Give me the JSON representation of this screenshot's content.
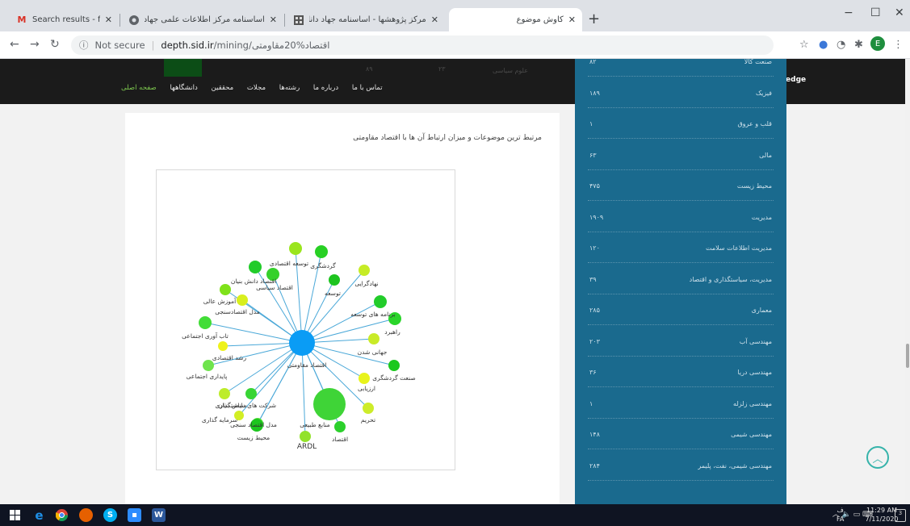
{
  "browser": {
    "tabs": [
      {
        "title": "Search results - f.azimzadeh@gm",
        "icon": "gmail-icon",
        "active": false
      },
      {
        "title": "اساسنامه مرکز اطلاعات علمی جهاد",
        "icon": "chrome-icon",
        "active": false
      },
      {
        "title": "مرکز پژوهشها - اساسنامه جهاد دانا",
        "icon": "site-icon",
        "active": false
      },
      {
        "title": "کاوش موضوع",
        "icon": "none",
        "active": true
      }
    ],
    "new_tab": "+",
    "window_buttons": {
      "minimize": "−",
      "maximize": "☐",
      "close": "✕"
    },
    "not_secure": "Not secure",
    "url_host": "depth.sid.ir",
    "url_path": "/mining/اقتصاد%20مقاومتی",
    "profile_letter": "E"
  },
  "site": {
    "logo_text": "Depth of Knowledge",
    "menu": [
      "صفحه اصلی",
      "دانشگاهها",
      "محققین",
      "مجلات",
      "رشته‌ها",
      "درباره ما",
      "تماس با ما"
    ],
    "ghost_texts": [
      "علوم سیاسی",
      "۲۳",
      "۸۹"
    ],
    "card_title": "مرتبط ترین موضوعات و میزان ارتباط آن ها با اقتصاد مقاومتی",
    "graph": {
      "center": "اقتصاد مقاومتی",
      "nodes": [
        {
          "label": "توسعه اقتصادی",
          "color": "#9ae51e",
          "r": 8
        },
        {
          "label": "گردشگری",
          "color": "#28d024",
          "r": 8
        },
        {
          "label": "اقتصاد دانش بنیان",
          "color": "#22cc2a",
          "r": 8
        },
        {
          "label": "اقتصاد سیاسی",
          "color": "#36d12b",
          "r": 8
        },
        {
          "label": "توسعه",
          "color": "#1dc41f",
          "r": 7
        },
        {
          "label": "نهادگرایی",
          "color": "#c6ec26",
          "r": 7
        },
        {
          "label": "آموزش عالی",
          "color": "#7fe21a",
          "r": 7
        },
        {
          "label": "مدل اقتصادسنجی",
          "color": "#d8ef1e",
          "r": 7
        },
        {
          "label": "برنامه های توسعه",
          "color": "#22cc2a",
          "r": 8
        },
        {
          "label": "راهبرد",
          "color": "#2ad52a",
          "r": 8
        },
        {
          "label": "تاب آوری اجتماعی",
          "color": "#42dd37",
          "r": 8
        },
        {
          "label": "جهانی شدن",
          "color": "#c9eb28",
          "r": 7
        },
        {
          "label": "رشد اقتصادی",
          "color": "#eef21a",
          "r": 6
        },
        {
          "label": "پایداری اجتماعی",
          "color": "#6fe44d",
          "r": 7
        },
        {
          "label": "صنعت گردشگری",
          "color": "#1bc81d",
          "r": 7
        },
        {
          "label": "ارزیابی",
          "color": "#e8f31c",
          "r": 7
        },
        {
          "label": "سیاستگذاری",
          "color": "#bdec2a",
          "r": 7
        },
        {
          "label": "شرکت های دانش بنیان",
          "color": "#38d535",
          "r": 7
        },
        {
          "label": "سرمایه گذاری",
          "color": "#d2ee24",
          "r": 6
        },
        {
          "label": "مدل اقتصاد سنجی",
          "color": "#57df3c",
          "r": 7
        },
        {
          "label": "منابع طبیعی",
          "color": "#3fd437",
          "r": 20
        },
        {
          "label": "تحریم",
          "color": "#cdec2a",
          "r": 7
        },
        {
          "label": "محیط زیست",
          "color": "#1cc61e",
          "r": 8
        },
        {
          "label": "ARDL",
          "color": "#92e22a",
          "r": 7
        },
        {
          "label": "اقتصاد",
          "color": "#2cd02c",
          "r": 7
        }
      ]
    },
    "sidebar": [
      {
        "name": "صنعت کالا",
        "count": "۸۲"
      },
      {
        "name": "فیزیک",
        "count": "۱۸۹"
      },
      {
        "name": "قلب و عروق",
        "count": "۱"
      },
      {
        "name": "مالی",
        "count": "۶۳"
      },
      {
        "name": "محیط زیست",
        "count": "۴۷۵"
      },
      {
        "name": "مدیریت",
        "count": "۱۹۰۹"
      },
      {
        "name": "مدیریت اطلاعات سلامت",
        "count": "۱۲۰"
      },
      {
        "name": "مدیریت، سیاستگذاری و اقتصاد",
        "count": "۳۹"
      },
      {
        "name": "معماری",
        "count": "۲۸۵"
      },
      {
        "name": "مهندسی آب",
        "count": "۲۰۳"
      },
      {
        "name": "مهندسی دریا",
        "count": "۳۶"
      },
      {
        "name": "مهندسی زلزله",
        "count": "۱"
      },
      {
        "name": "مهندسی شیمی",
        "count": "۱۴۸"
      },
      {
        "name": "مهندسی شیمی، نفت، پلیمر",
        "count": "۲۸۴"
      }
    ]
  },
  "taskbar": {
    "time": "11:29 AM",
    "date": "7/11/2020",
    "lang_top": "ف",
    "lang_bottom": "FA",
    "notification_count": "3"
  }
}
